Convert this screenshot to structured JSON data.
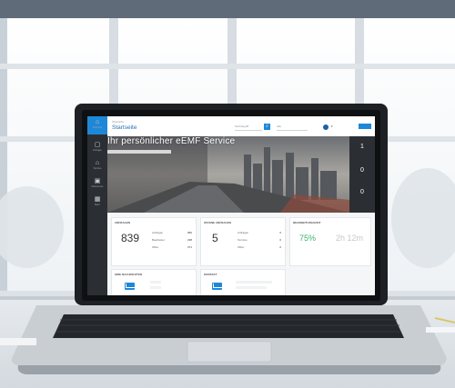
{
  "screen": {
    "sidebar": {
      "items": [
        {
          "icon": "home-icon",
          "label": "Startseite"
        },
        {
          "icon": "chat-icon",
          "label": "Anfragen"
        },
        {
          "icon": "calendar-icon",
          "label": "Termine"
        },
        {
          "icon": "document-icon",
          "label": "Dokumente"
        },
        {
          "icon": "grid-icon",
          "label": "Mehr"
        }
      ]
    },
    "topbar": {
      "breadcrumb": "Übersicht",
      "title": "Startseite",
      "search_placeholder": "Suchbegriff",
      "select_value": "Alle"
    },
    "hero": {
      "title": "Ihr persönlicher eEMF Service"
    },
    "right_panel": {
      "values": [
        "1",
        "0",
        "0"
      ]
    },
    "cards": {
      "first": {
        "title": "ANFRAGEN",
        "big": "839",
        "rows": [
          [
            "Anfragen",
            "960"
          ],
          [
            "Bearbeitet",
            "238"
          ],
          [
            "Offen",
            "371"
          ]
        ]
      },
      "second": {
        "title": "OFFENE ANFRAGEN",
        "big": "5",
        "rows": [
          [
            "Anfragen",
            "0"
          ],
          [
            "Termine",
            "0"
          ],
          [
            "Offen",
            "0"
          ]
        ]
      },
      "third": {
        "title": "BEARBEITUNGSZEIT",
        "pct": "75%",
        "time": "2h 12m"
      }
    },
    "bottom": {
      "left_title": "IHRE NACHRICHTEN",
      "right_title": "KONTAKT"
    }
  },
  "colors": {
    "accent": "#1e88d8",
    "sidebar": "#2b2f34",
    "highlight_green": "#3cb371"
  }
}
